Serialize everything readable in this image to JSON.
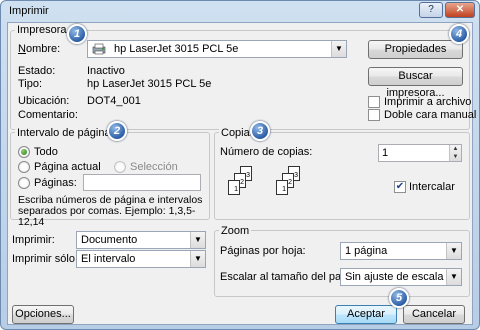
{
  "window": {
    "title": "Imprimir",
    "help_label": "?",
    "close_label": "✕"
  },
  "printer": {
    "group_label": "Impresora",
    "name_label": "Nombre:",
    "name_value": "hp LaserJet 3015 PCL 5e",
    "status_label": "Estado:",
    "status_value": "Inactivo",
    "type_label": "Tipo:",
    "type_value": "hp LaserJet 3015 PCL 5e",
    "location_label": "Ubicación:",
    "location_value": "DOT4_001",
    "comment_label": "Comentario:",
    "properties_button": "Propiedades",
    "find_button": "Buscar impresora...",
    "print_to_file_label": "Imprimir a archivo",
    "print_to_file_checked": false,
    "duplex_label": "Doble cara manual",
    "duplex_checked": false
  },
  "page_range": {
    "group_label": "Intervalo de páginas",
    "all_label": "Todo",
    "current_label": "Página actual",
    "selection_label": "Selección",
    "pages_label": "Páginas:",
    "pages_value": "",
    "selected": "all",
    "hint": "Escriba números de página e intervalos separados por comas. Ejemplo: 1,3,5-12,14"
  },
  "copies": {
    "group_label": "Copias",
    "count_label": "Número de copias:",
    "count_value": "1",
    "collate_label": "Intercalar",
    "collate_checked": true,
    "page_numbers": [
      "1",
      "2",
      "3"
    ]
  },
  "print_what": {
    "print_label": "Imprimir:",
    "print_value": "Documento",
    "print_only_label": "Imprimir sólo:",
    "print_only_value": "El intervalo"
  },
  "zoom": {
    "group_label": "Zoom",
    "pages_per_sheet_label": "Páginas por hoja:",
    "pages_per_sheet_value": "1 página",
    "scale_label": "Escalar al tamaño del papel:",
    "scale_value": "Sin ajuste de escala"
  },
  "footer": {
    "options_button": "Opciones...",
    "ok_button": "Aceptar",
    "cancel_button": "Cancelar"
  },
  "callouts": [
    "1",
    "2",
    "3",
    "4",
    "5"
  ]
}
